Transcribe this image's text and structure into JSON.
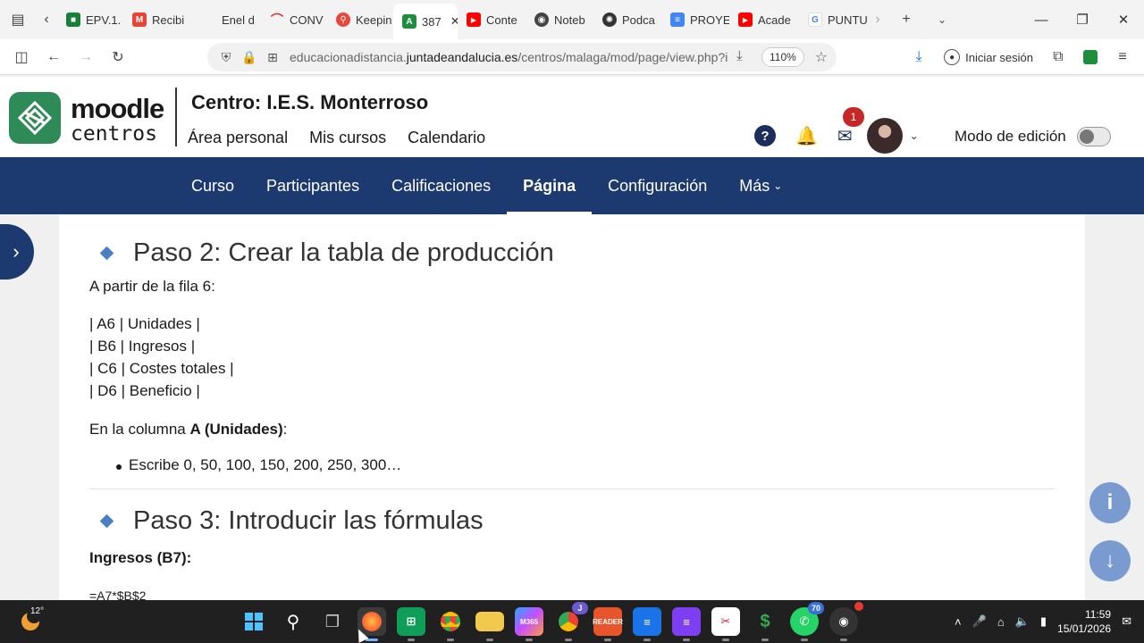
{
  "browser": {
    "tabs": [
      {
        "label": "EPV.1.",
        "icon": "classroom-icon",
        "color": "#188038"
      },
      {
        "label": "Recibi",
        "icon": "gmail-icon",
        "color": "#ea4335"
      },
      {
        "label": "Enel d",
        "icon": "enel-icon",
        "color": "#aaaaaa"
      },
      {
        "label": "CONV",
        "icon": "conv-icon",
        "color": "#d93025"
      },
      {
        "label": "Keepin",
        "icon": "keepin-icon",
        "color": "#e8453c"
      },
      {
        "label": "387",
        "icon": "moodle-tab-icon",
        "color": "#1e8e3e",
        "active": true
      },
      {
        "label": "Conte",
        "icon": "youtube-icon",
        "color": "#ff0000"
      },
      {
        "label": "Noteb",
        "icon": "notebook-icon",
        "color": "#444444"
      },
      {
        "label": "Podca",
        "icon": "openai-icon",
        "color": "#333333"
      },
      {
        "label": "PROYE",
        "icon": "docs-icon",
        "color": "#4285f4"
      },
      {
        "label": "Acade",
        "icon": "youtube-icon",
        "color": "#ff0000"
      },
      {
        "label": "PUNTU",
        "icon": "google-icon",
        "color": "#4285f4"
      }
    ],
    "url_prefix": "educacionadistancia.",
    "url_domain": "juntadeandalucia.es",
    "url_path": "/centros/malaga/mod/page/view.php?id",
    "zoom": "110%",
    "signin_label": "Iniciar sesión"
  },
  "moodle": {
    "logo_line1": "moodle",
    "logo_line2": "centros",
    "site_title": "Centro:  I.E.S. Monterroso",
    "primary_nav": [
      "Área personal",
      "Mis cursos",
      "Calendario"
    ],
    "help_label": "?",
    "message_count": "1",
    "edit_mode_label": "Modo de edición",
    "secondary_nav": [
      "Curso",
      "Participantes",
      "Calificaciones",
      "Página",
      "Configuración",
      "Más"
    ],
    "secondary_nav_active": "Página"
  },
  "content": {
    "step2_title": "Paso 2: Crear la tabla de producción",
    "step2_intro": "A partir de la fila 6:",
    "table_lines": [
      "| A6 | Unidades |",
      "| B6 | Ingresos |",
      "| C6 | Costes totales |",
      "| D6 | Beneficio |"
    ],
    "column_text_before": "En la columna ",
    "column_text_bold": "A (Unidades)",
    "column_text_after": ":",
    "bullet": "Escribe 0, 50, 100, 150, 200, 250, 300…",
    "step3_title": "Paso 3: Introducir las fórmulas",
    "ingresos_label": "Ingresos (B7):",
    "formula_partial": "=A7*$B$2"
  },
  "taskbar": {
    "temperature": "12°",
    "time": "11:59",
    "date": "15/01/2026",
    "whatsapp_badge": "70",
    "chrome_badge": "J"
  }
}
